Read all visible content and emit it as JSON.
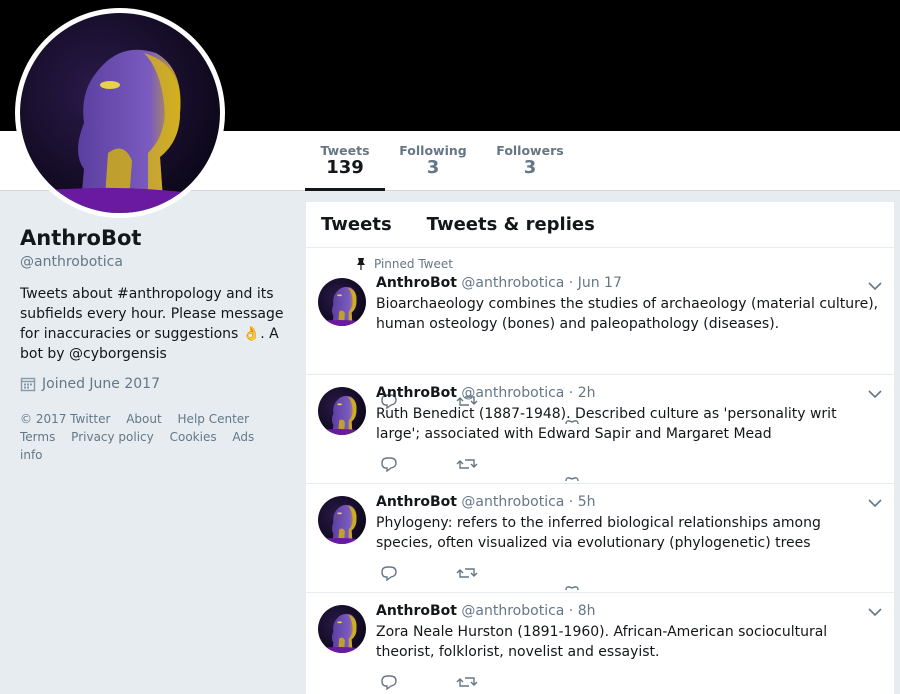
{
  "profile": {
    "name": "AnthroBot",
    "handle": "@anthrobotica",
    "bio_text": "Tweets about #anthropology and its subfields every hour. Please message for inaccuracies or suggestions 👌. A bot by",
    "bio_link": "@cyborgensis",
    "joined": "Joined June 2017"
  },
  "stats": [
    {
      "label": "Tweets",
      "value": "139"
    },
    {
      "label": "Following",
      "value": "3"
    },
    {
      "label": "Followers",
      "value": "3"
    }
  ],
  "footer": {
    "copyright": "© 2017 Twitter",
    "links": [
      "About",
      "Help Center",
      "Terms",
      "Privacy policy",
      "Cookies",
      "Ads info"
    ]
  },
  "timeline": {
    "tabs": [
      "Tweets",
      "Tweets & replies"
    ],
    "pinned_label": "Pinned Tweet",
    "tweets": [
      {
        "name": "AnthroBot",
        "meta": "@anthrobotica · Jun 17",
        "text": "Bioarchaeology combines the studies of archaeology (material culture), human osteology (bones)  and paleopathology (diseases)."
      },
      {
        "name": "AnthroBot",
        "meta": "@anthrobotica · 2h",
        "text": "Ruth Benedict (1887-1948). Described culture as 'personality writ large'; associated with Edward Sapir and Margaret Mead"
      },
      {
        "name": "AnthroBot",
        "meta": "@anthrobotica · 5h",
        "text": "Phylogeny: refers to the inferred biological relationships among species, often visualized via evolutionary (phylogenetic) trees"
      },
      {
        "name": "AnthroBot",
        "meta": "@anthrobotica · 8h",
        "text": "Zora Neale Hurston (1891-1960). African-American sociocultural theorist, folklorist, novelist and essayist."
      }
    ]
  },
  "colors": {
    "accent": "#1da1f2",
    "muted": "#657786",
    "banner": "#000000",
    "page_bg": "#e6ecf0"
  },
  "icons": [
    "pin-icon",
    "calendar-icon",
    "reply-icon",
    "retweet-icon",
    "like-icon",
    "chevron-down-icon"
  ]
}
